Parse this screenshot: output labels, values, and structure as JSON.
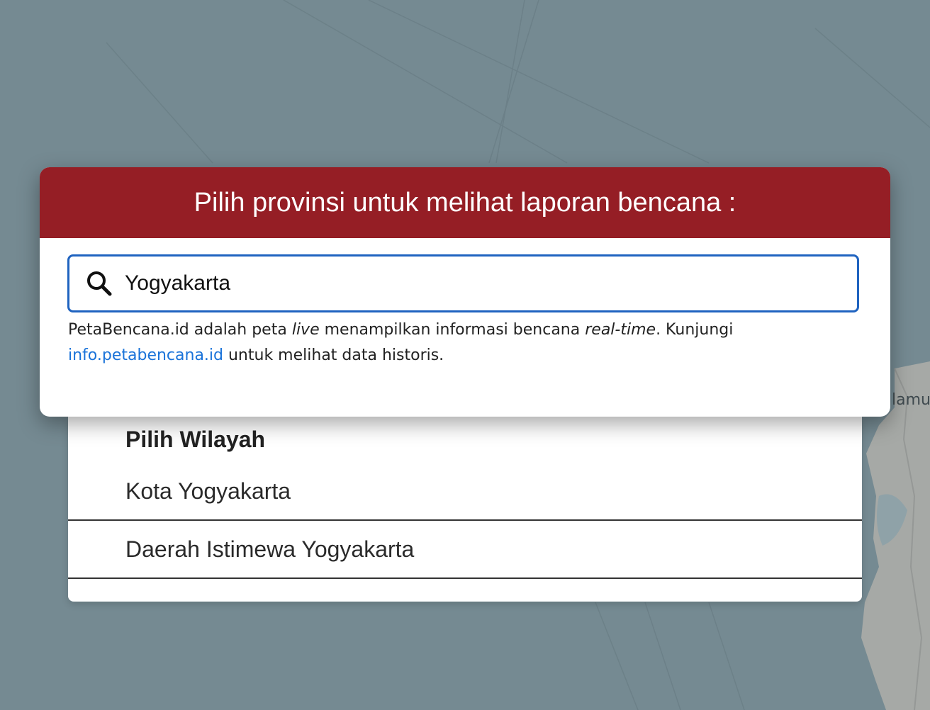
{
  "modal": {
    "title": "Pilih provinsi untuk melihat laporan bencana :",
    "search": {
      "value": "Yogyakarta",
      "icon": "search-icon"
    },
    "info": {
      "part1": "PetaBencana.id adalah peta ",
      "live": "live",
      "part2": " menampilkan informasi bencana ",
      "realtime": "real-time",
      "part3": ". Kunjungi ",
      "link": "info.petabencana.id",
      "part4": " untuk melihat data historis."
    }
  },
  "dropdown": {
    "title": "Pilih Wilayah",
    "items": [
      {
        "label": "Kota Yogyakarta"
      },
      {
        "label": "Daerah Istimewa Yogyakarta"
      }
    ]
  },
  "map": {
    "label": "lamu"
  },
  "colors": {
    "header": "#951e25",
    "accent": "#1f63c0",
    "link": "#1a73d9",
    "map_water": "#758a92"
  }
}
